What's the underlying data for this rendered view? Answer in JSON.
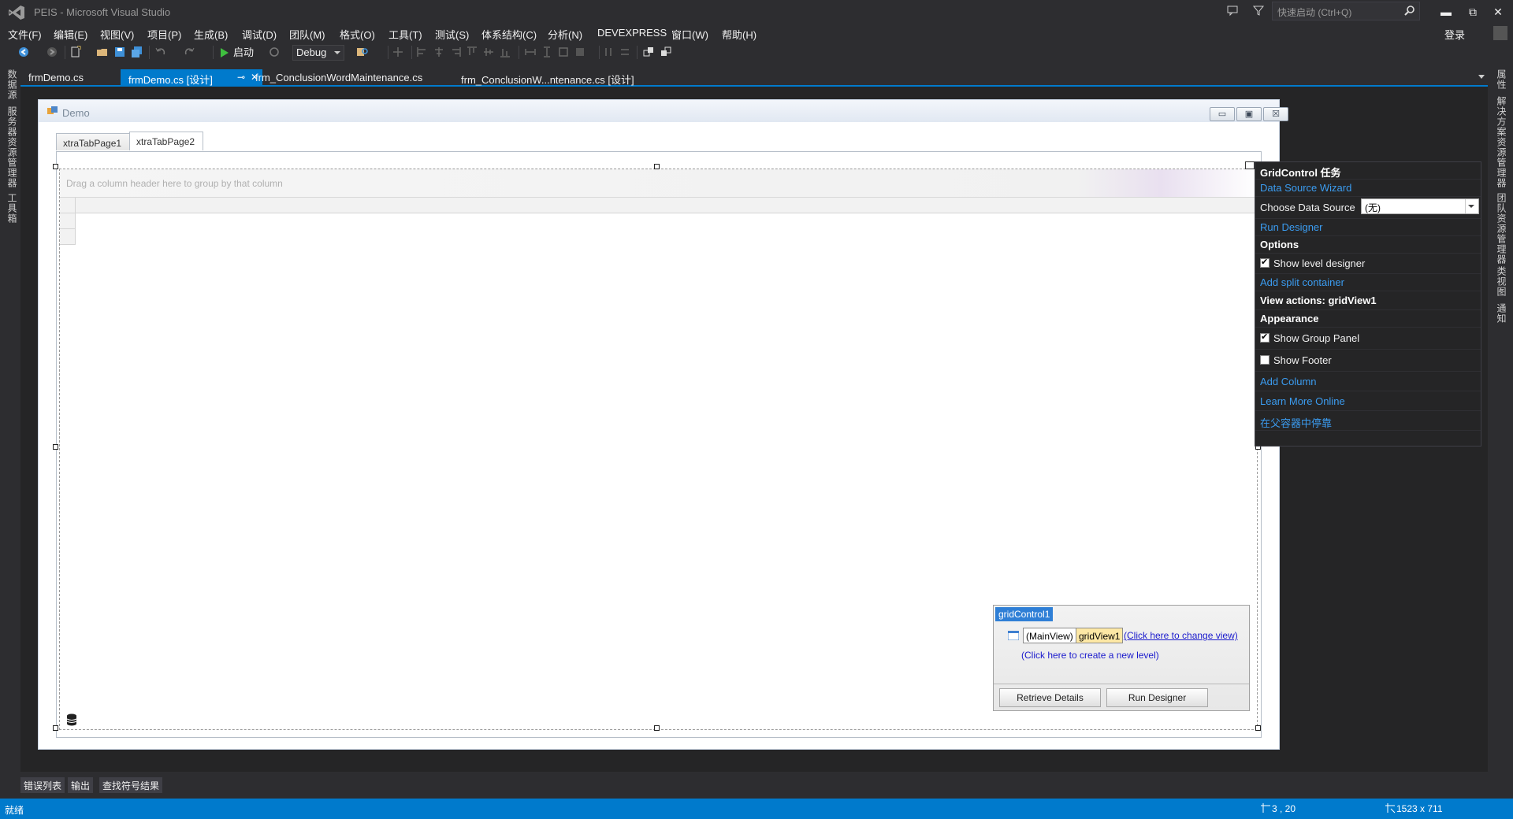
{
  "window": {
    "title": "PEIS - Microsoft Visual Studio",
    "quick_launch_placeholder": "快速启动 (Ctrl+Q)",
    "minimize": "▬",
    "restore": "⧉",
    "close": "✕"
  },
  "menu": {
    "items": [
      "文件(F)",
      "编辑(E)",
      "视图(V)",
      "项目(P)",
      "生成(B)",
      "调试(D)",
      "团队(M)",
      "格式(O)",
      "工具(T)",
      "测试(S)",
      "体系结构(C)",
      "分析(N)",
      "DEVEXPRESS",
      "窗口(W)",
      "帮助(H)"
    ],
    "sign_in": "登录"
  },
  "toolbar": {
    "start_label": "启动",
    "configuration": "Debug"
  },
  "left_sidebar": {
    "tabs": [
      "数据源",
      "服务器资源管理器",
      "工具箱"
    ]
  },
  "right_sidebar": {
    "tabs": [
      "属性",
      "解决方案资源管理器",
      "团队资源管理器",
      "类视图",
      "通知"
    ]
  },
  "doc_tabs": [
    {
      "label": "frmDemo.cs",
      "active": false
    },
    {
      "label": "frmDemo.cs [设计]",
      "active": true,
      "pin": "⊸",
      "close": "✕"
    },
    {
      "label": "frm_ConclusionWordMaintenance.cs",
      "active": false
    },
    {
      "label": "frm_ConclusionW...ntenance.cs [设计]",
      "active": false
    }
  ],
  "form": {
    "title": "Demo",
    "min": "▭",
    "max": "▣",
    "close": "☒",
    "tabs": [
      "xtraTabPage1",
      "xtraTabPage2"
    ],
    "active_tab_index": 1
  },
  "grid": {
    "group_panel_text": "Drag a column header here to group by that column"
  },
  "level_designer": {
    "title": "gridControl1",
    "main_view": "(MainView)",
    "grid_view": "gridView1",
    "change_view_link": "(Click here to change view)",
    "new_level_link": "(Click here to create a new level)",
    "retrieve_details": "Retrieve Details",
    "run_designer": "Run Designer"
  },
  "smart_tag": {
    "header": "GridControl 任务",
    "data_source_wizard": "Data Source Wizard",
    "choose_data_source_label": "Choose Data Source",
    "choose_data_source_value": "(无)",
    "run_designer": "Run Designer",
    "options_header": "Options",
    "show_level_designer": {
      "label": "Show level designer",
      "checked": true
    },
    "add_split_container": "Add split container",
    "view_actions_header": "View actions: gridView1",
    "appearance_header": "Appearance",
    "show_group_panel": {
      "label": "Show Group Panel",
      "checked": true
    },
    "show_footer": {
      "label": "Show Footer",
      "checked": false
    },
    "add_column": "Add Column",
    "learn_more": "Learn More Online",
    "dock_in_parent": "在父容器中停靠"
  },
  "bottom_tabs": [
    "错误列表",
    "输出",
    "查找符号结果"
  ],
  "status": {
    "ready": "就绪",
    "position": "3 , 20",
    "size": "1523 x 711"
  },
  "colors": {
    "accent": "#007acc",
    "link": "#3b9cf0",
    "ide_bg": "#2d2d30"
  }
}
